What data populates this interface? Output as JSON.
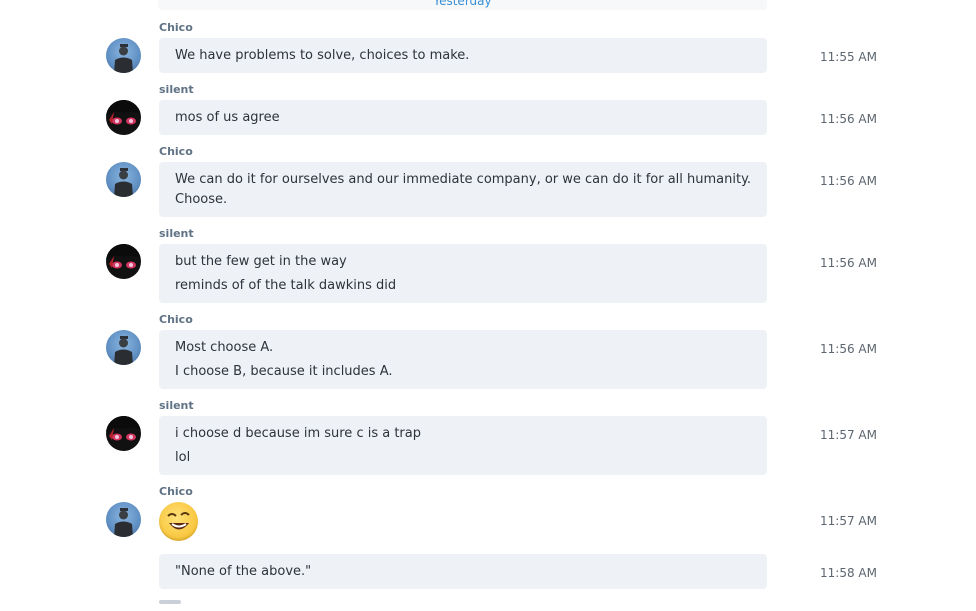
{
  "date_divider": "Yesterday",
  "messages": [
    {
      "sender": "Chico",
      "lines": [
        "We have problems to solve, choices to make."
      ],
      "time": "11:55 AM"
    },
    {
      "sender": "silent",
      "lines": [
        "mos of us agree"
      ],
      "time": "11:56 AM"
    },
    {
      "sender": "Chico",
      "lines": [
        "We can do it for ourselves and our immediate company, or we can do it for all humanity.",
        "Choose."
      ],
      "time": "11:56 AM"
    },
    {
      "sender": "silent",
      "lines": [
        "but the few get in the way",
        "reminds of of the talk dawkins did"
      ],
      "time": "11:56 AM"
    },
    {
      "sender": "Chico",
      "lines": [
        "Most choose A.",
        "I choose B, because it includes A."
      ],
      "time": "11:56 AM"
    },
    {
      "sender": "silent",
      "lines": [
        "i choose d because im sure c is a trap",
        "lol"
      ],
      "time": "11:57 AM"
    },
    {
      "sender": "Chico",
      "emoji": "laughing-face-emoji",
      "time": "11:57 AM"
    },
    {
      "lines": [
        "\"None of the above.\""
      ],
      "time": "11:58 AM"
    }
  ],
  "colors": {
    "bubble": "#eef1f5",
    "accent": "#3a8fd6",
    "sender": "#5f7285"
  }
}
